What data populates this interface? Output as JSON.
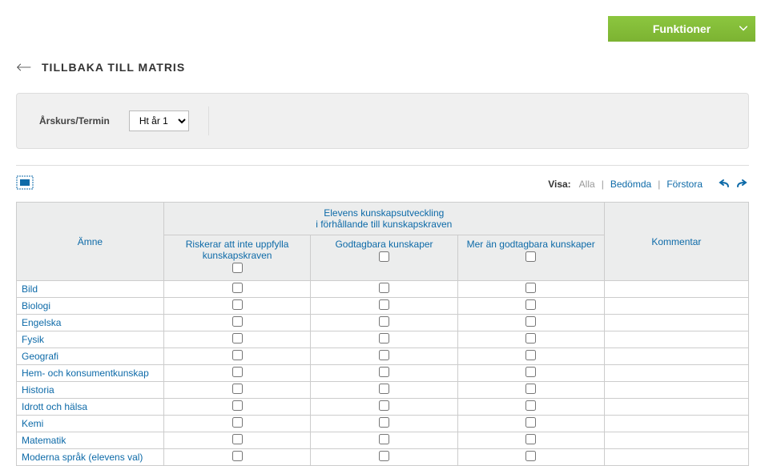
{
  "funktioner_label": "Funktioner",
  "back_title": "TILLBAKA TILL MATRIS",
  "filter": {
    "label": "Årskurs/Termin",
    "selected": "Ht år 1"
  },
  "visa": {
    "label": "Visa:",
    "alla": "Alla",
    "bedomda": "Bedömda",
    "forstora": "Förstora"
  },
  "table_headers": {
    "amne": "Ämne",
    "elevens_line1": "Elevens kunskapsutveckling",
    "elevens_line2": "i förhållande till kunskapskraven",
    "kommentar": "Kommentar",
    "col1": "Riskerar att inte uppfylla kunskapskraven",
    "col2": "Godtagbara kunskaper",
    "col3": "Mer än godtagbara kunskaper"
  },
  "subjects": [
    "Bild",
    "Biologi",
    "Engelska",
    "Fysik",
    "Geografi",
    "Hem- och konsumentkunskap",
    "Historia",
    "Idrott och hälsa",
    "Kemi",
    "Matematik",
    "Moderna språk (elevens val)"
  ]
}
